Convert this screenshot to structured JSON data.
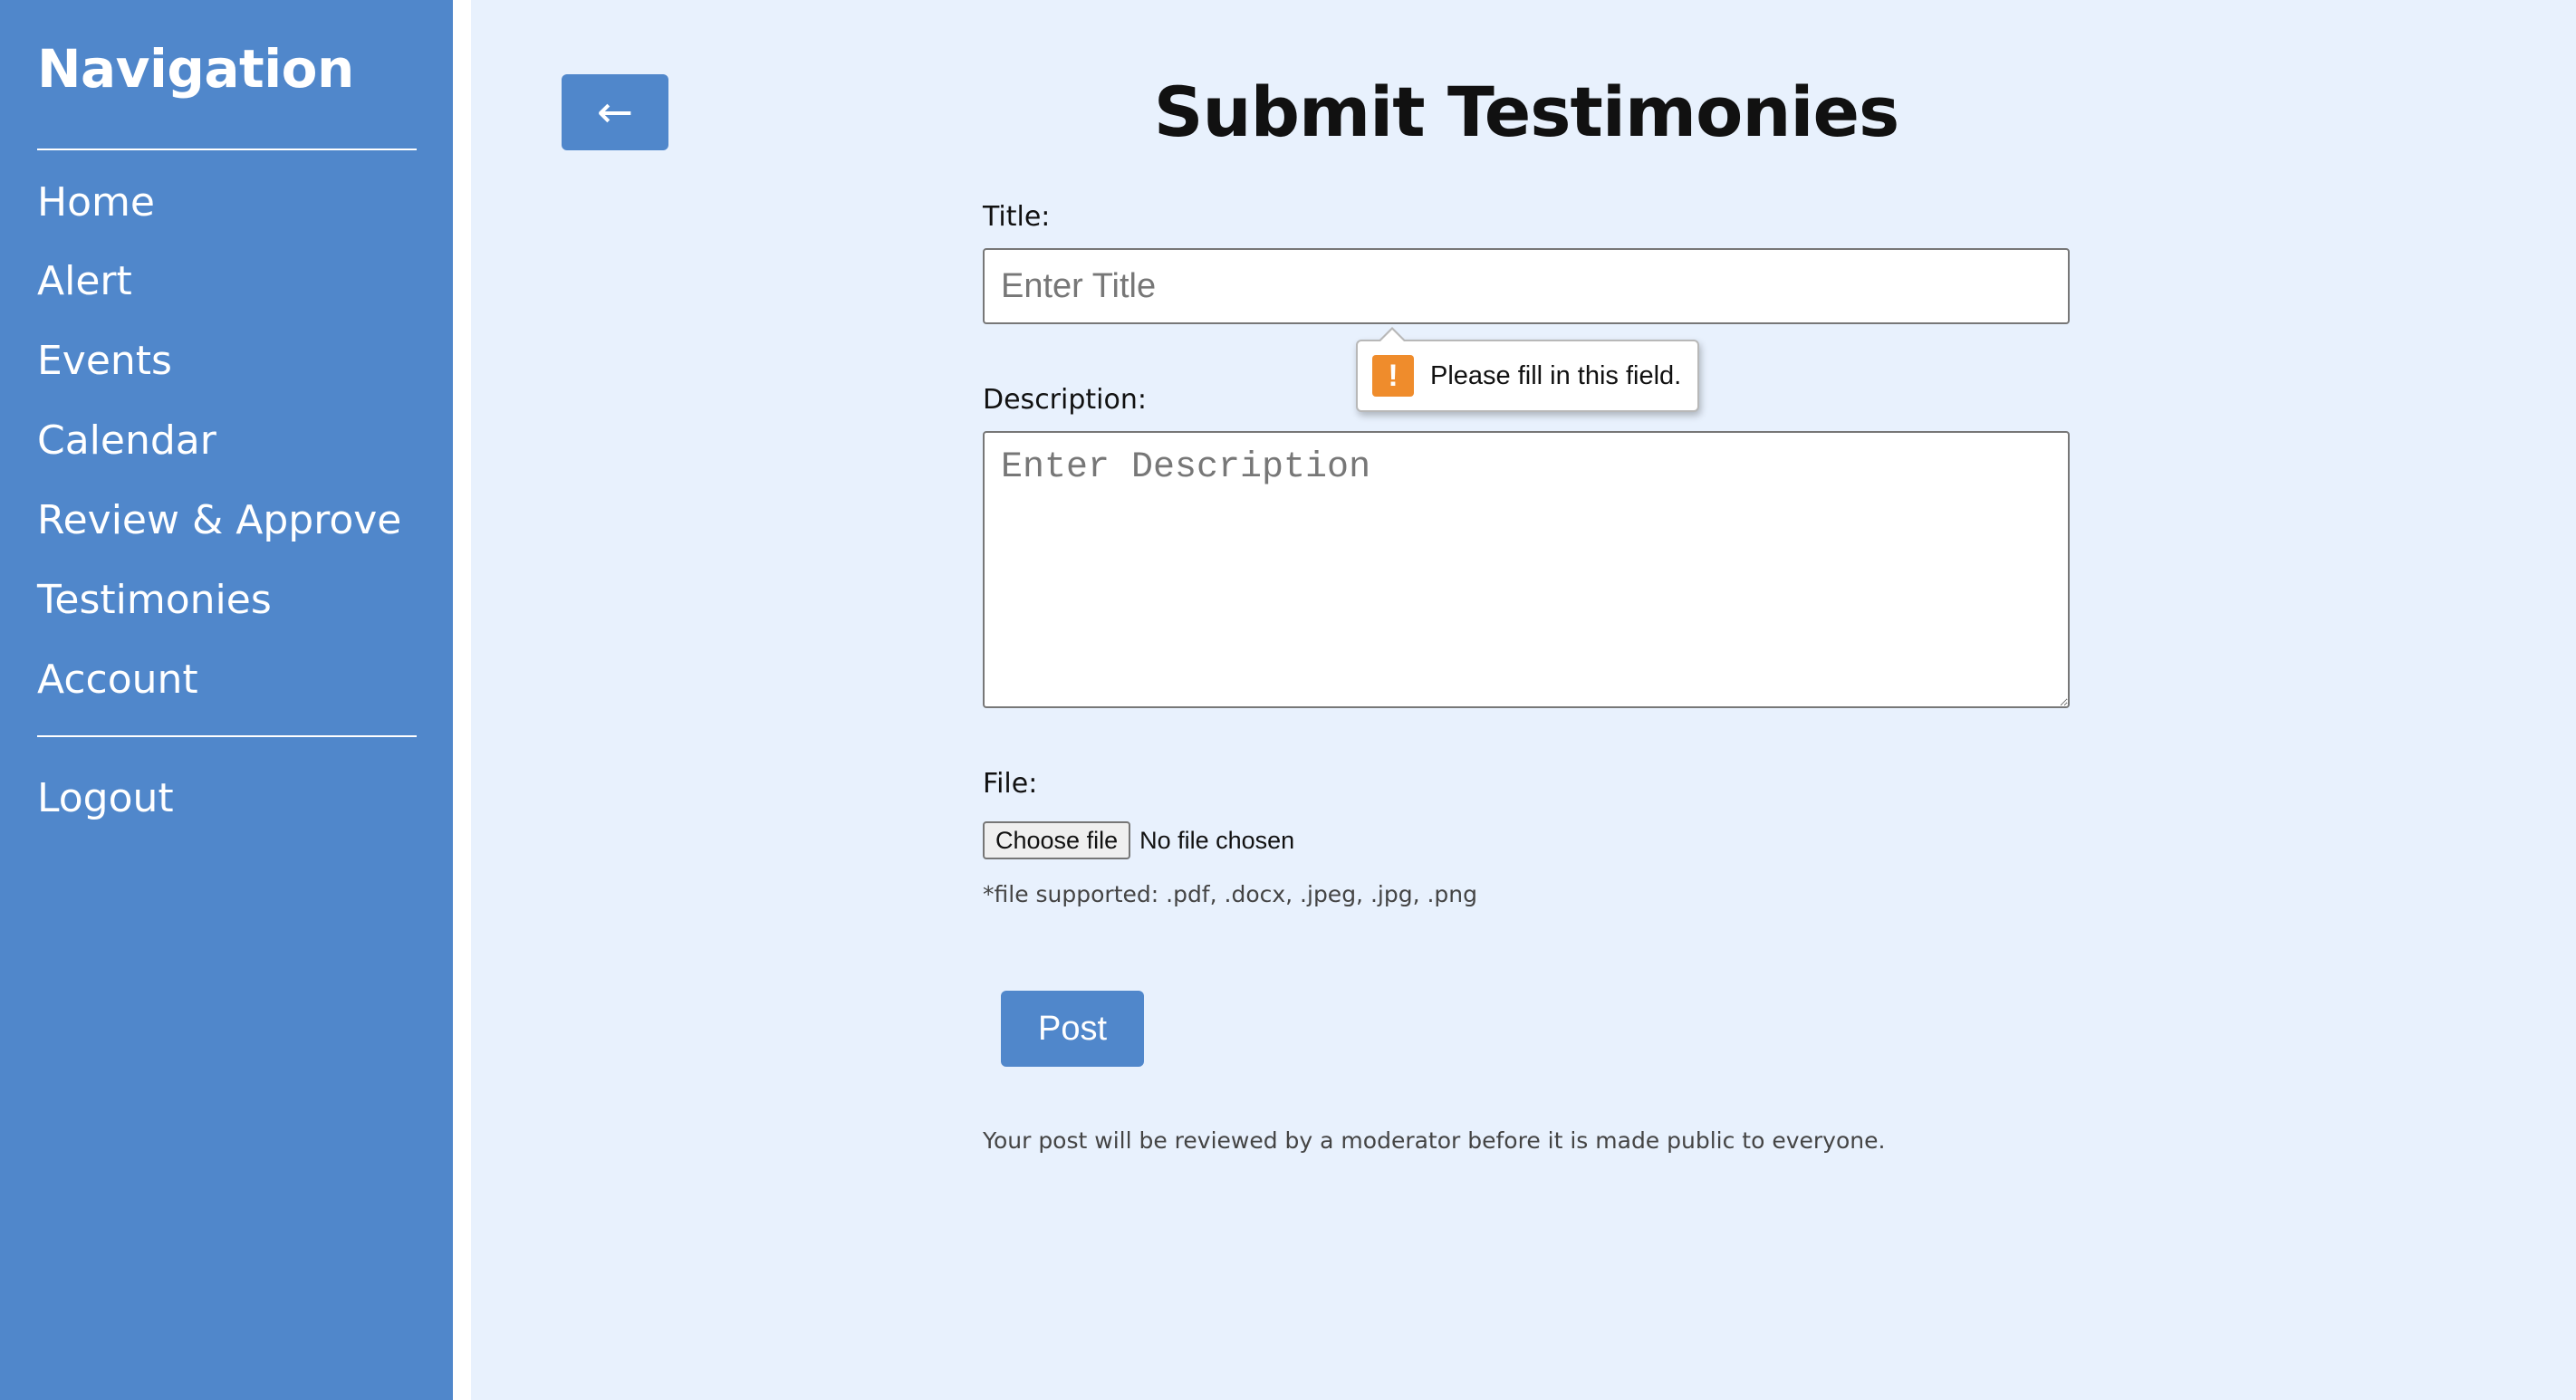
{
  "sidebar": {
    "title": "Navigation",
    "items": [
      {
        "label": "Home"
      },
      {
        "label": "Alert"
      },
      {
        "label": "Events"
      },
      {
        "label": "Calendar"
      },
      {
        "label": "Review & Approve"
      },
      {
        "label": "Testimonies"
      },
      {
        "label": "Account"
      }
    ],
    "logout_label": "Logout"
  },
  "header": {
    "back_label": "←",
    "title": "Submit Testimonies"
  },
  "form": {
    "title_label": "Title:",
    "title_placeholder": "Enter Title",
    "title_value": "",
    "validation_message": "Please fill in this field.",
    "validation_icon": "warning-icon",
    "description_label": "Description:",
    "description_placeholder": "Enter Description",
    "description_value": "",
    "file_label": "File:",
    "file_button_label": "Choose file",
    "file_status": "No file chosen",
    "file_hint": "*file supported: .pdf, .docx, .jpeg, .jpg, .png",
    "post_label": "Post",
    "note": "Your post will be reviewed by a moderator before it is made public to everyone."
  },
  "colors": {
    "sidebar_bg": "#5087cb",
    "main_bg": "#e8f1fd",
    "accent": "#5087cb",
    "warning": "#ef8c2c"
  }
}
